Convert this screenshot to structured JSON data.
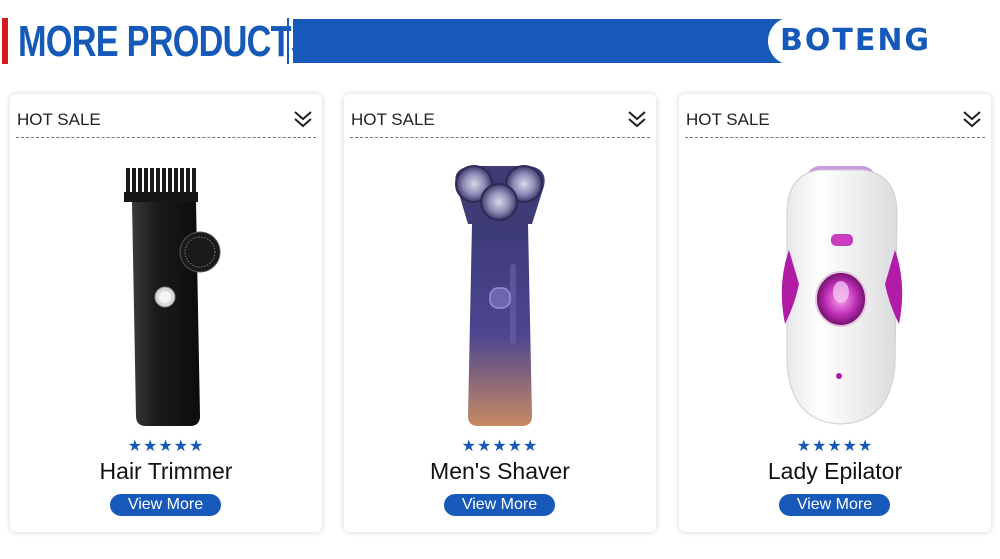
{
  "header": {
    "title": "MORE PRODUCTS",
    "brand": "BOTENG",
    "colors": {
      "accent_red": "#d21b1b",
      "brand_blue": "#1659b8"
    }
  },
  "cards": [
    {
      "tag": "HOT SALE",
      "chevron_icon": "chevron-double-down-icon",
      "rating": 5,
      "stars": "★★★★★",
      "name": "Hair Trimmer",
      "button": "View More",
      "image_icon": "hair-trimmer-image"
    },
    {
      "tag": "HOT SALE",
      "chevron_icon": "chevron-double-down-icon",
      "rating": 5,
      "stars": "★★★★★",
      "name": "Men's Shaver",
      "button": "View More",
      "image_icon": "shaver-image"
    },
    {
      "tag": "HOT SALE",
      "chevron_icon": "chevron-double-down-icon",
      "rating": 5,
      "stars": "★★★★★",
      "name": "Lady Epilator",
      "button": "View More",
      "image_icon": "epilator-image"
    }
  ]
}
